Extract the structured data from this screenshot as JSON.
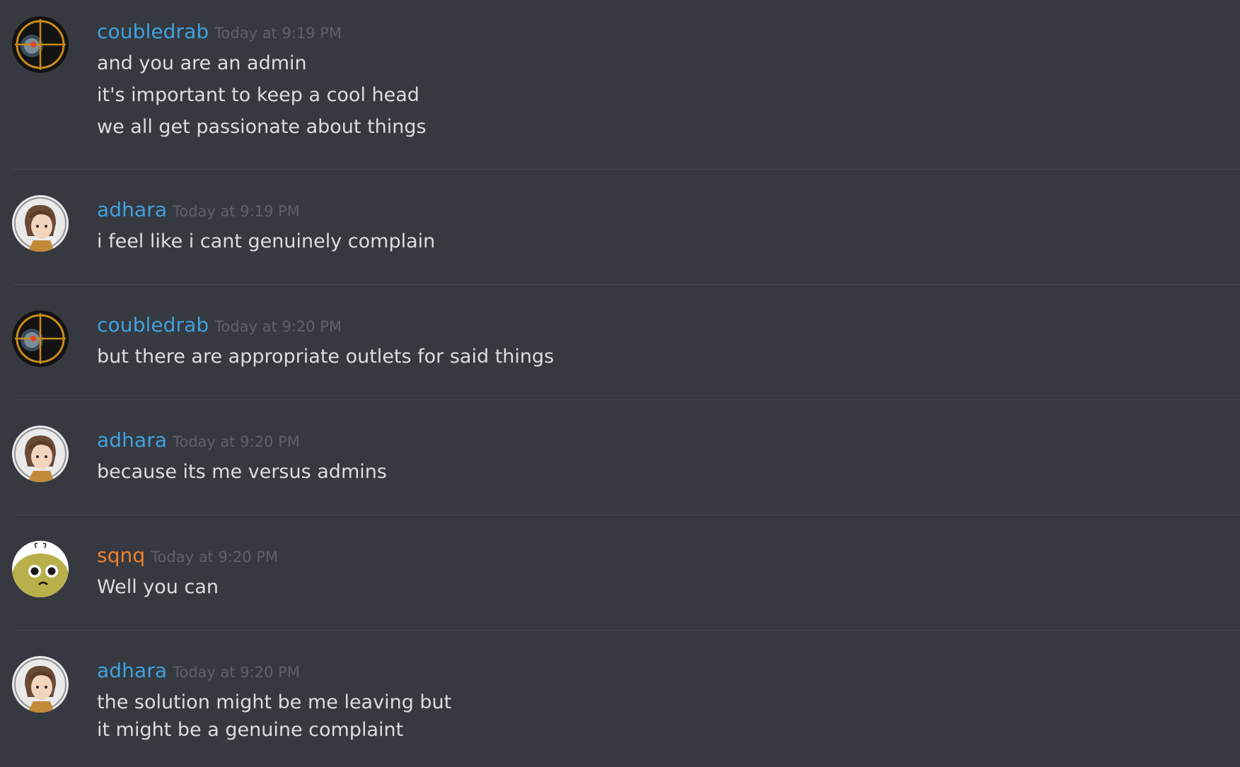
{
  "colors": {
    "background": "#36393f",
    "divider": "#42454a",
    "text": "#dcddde",
    "timestamp": "#5e6167",
    "username_blue": "#3fa2e0",
    "username_orange": "#f0812e"
  },
  "messages": [
    {
      "author": "coubledrab",
      "author_color": "#3fa2e0",
      "avatar": "crosshair-orb-avatar-icon",
      "timestamp": "Today at 9:19 PM",
      "lines": [
        "and you are an admin",
        "it's important to keep a cool head",
        "we all get passionate about things"
      ]
    },
    {
      "author": "adhara",
      "author_color": "#3fa2e0",
      "avatar": "anime-girl-avatar-icon",
      "timestamp": "Today at 9:19 PM",
      "lines": [
        "i feel like i cant genuinely complain"
      ]
    },
    {
      "author": "coubledrab",
      "author_color": "#3fa2e0",
      "avatar": "crosshair-orb-avatar-icon",
      "timestamp": "Today at 9:20 PM",
      "lines": [
        "but there are appropriate outlets for said things"
      ]
    },
    {
      "author": "adhara",
      "author_color": "#3fa2e0",
      "avatar": "anime-girl-avatar-icon",
      "timestamp": "Today at 9:20 PM",
      "lines": [
        "because its me versus admins"
      ]
    },
    {
      "author": "sqnq",
      "author_color": "#f0812e",
      "avatar": "bee-face-avatar-icon",
      "timestamp": "Today at 9:20 PM",
      "lines": [
        "Well you can"
      ]
    },
    {
      "author": "adhara",
      "author_color": "#3fa2e0",
      "avatar": "anime-girl-avatar-icon",
      "timestamp": "Today at 9:20 PM",
      "lines": [
        "the solution might be me leaving but",
        "it might be a genuine complaint"
      ]
    }
  ]
}
